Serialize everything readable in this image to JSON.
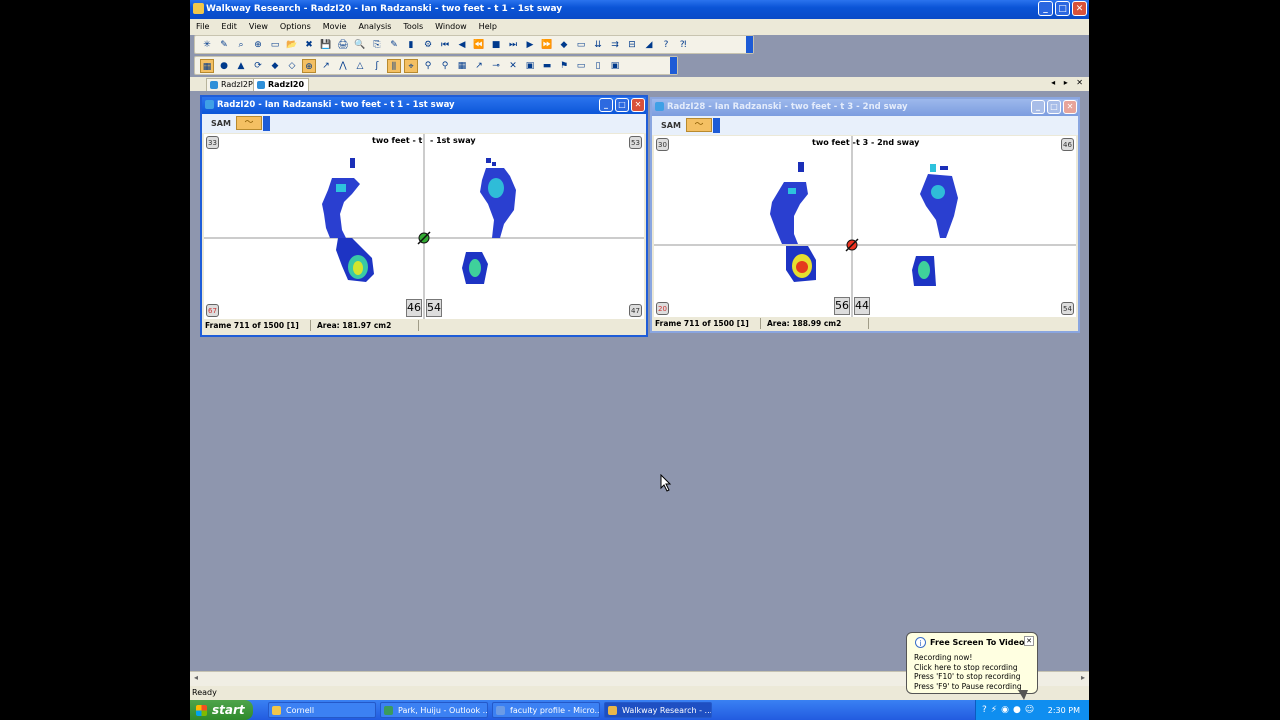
{
  "app": {
    "title": "Walkway Research - RadzI20 - Ian  Radzanski - two feet - t 1 - 1st sway",
    "min": "_",
    "max": "□",
    "close": "✕"
  },
  "menu": [
    "File",
    "Edit",
    "View",
    "Options",
    "Movie",
    "Analysis",
    "Tools",
    "Window",
    "Help"
  ],
  "toolbar1": [
    "✳",
    "✎",
    "⌕",
    "⊕",
    "▭",
    "📂",
    "✖",
    "💾",
    "🖨",
    "🔍",
    "⎘",
    "✎",
    "▮",
    "⚙",
    "⏮",
    "◀",
    "⏪",
    "■",
    "⏭",
    "▶",
    "⏩",
    "◆",
    "▭",
    "⇊",
    "⇉",
    "⊟",
    "◢",
    "?",
    "⁈"
  ],
  "toolbar2": [
    "▦",
    "●",
    "▲",
    "⟳",
    "◆",
    "◇",
    "⊕",
    "↗",
    "⋀",
    "△",
    "ʃ",
    "⫼",
    "⌖",
    "⚲",
    "⚲",
    "▦",
    "↗",
    "⊸",
    "✕",
    "▣",
    "▬",
    "⚑",
    "▭",
    "▯",
    "▣"
  ],
  "tabs": [
    {
      "label": "RadzI2P"
    },
    {
      "label": "RadzI20"
    }
  ],
  "tab_arrows": "◂ ▸ ✕",
  "windows": [
    {
      "title": "RadzI20 - Ian  Radzanski - two feet - t 1 - 1st sway",
      "sam": "SAM",
      "label_left": "two feet - t",
      "label_right": "- 1st sway",
      "corners": {
        "tl": "33",
        "tr": "53",
        "bl": "67",
        "br": "47"
      },
      "left_value": "46",
      "right_value": "54",
      "status_frame": "Frame 711 of 1500 [1]",
      "status_area": "Area: 181.97 cm2"
    },
    {
      "title": "RadzI28 - Ian  Radzanski - two feet - t 3 - 2nd sway",
      "sam": "SAM",
      "label_left": "two feet -",
      "label_right": "t 3 - 2nd sway",
      "corners": {
        "tl": "30",
        "tr": "46",
        "bl": "20",
        "br": "54"
      },
      "left_value": "56",
      "right_value": "44",
      "status_frame": "Frame 711 of 1500 [1]",
      "status_area": "Area: 188.99 cm2"
    }
  ],
  "statusbar": "Ready",
  "taskbar": {
    "start": "start",
    "items": [
      "Cornell",
      "Park, Huiju - Outlook ...",
      "faculty profile - Micro...",
      "Walkway Research - ..."
    ],
    "clock": "2:30 PM"
  },
  "balloon": {
    "title": "Free Screen To Video",
    "lines": [
      "Recording now!",
      "Click here to stop recording",
      "Press 'F10' to stop recording",
      "Press 'F9' to Pause recording"
    ]
  },
  "colors": {
    "xp_blue": "#0a54d6",
    "desktop": "#8e96ae",
    "pressure_low": "#1f2fbf",
    "pressure_high": "#e53a1d"
  }
}
